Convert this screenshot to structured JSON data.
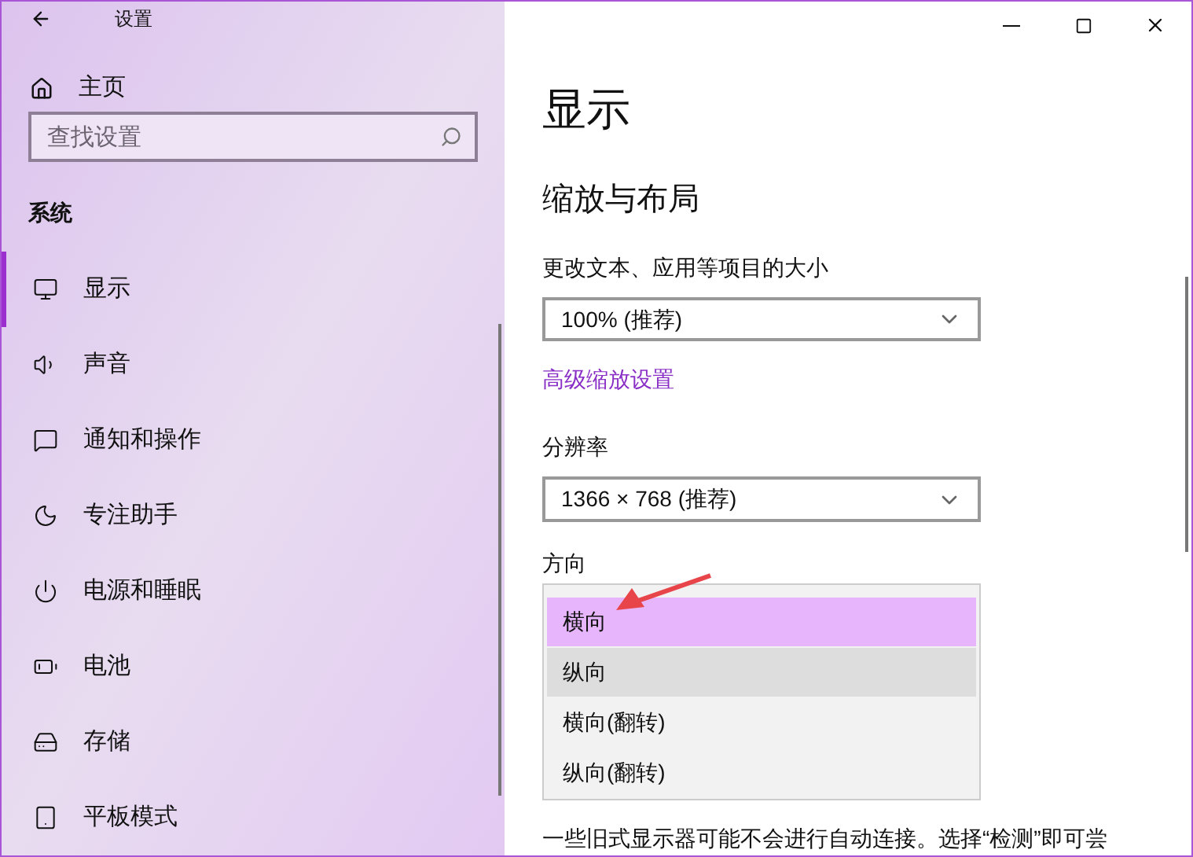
{
  "window": {
    "title": "设置"
  },
  "sidebar": {
    "home": "主页",
    "search": {
      "placeholder": "查找设置"
    },
    "section": "系统",
    "items": [
      {
        "label": "显示",
        "selected": true
      },
      {
        "label": "声音",
        "selected": false
      },
      {
        "label": "通知和操作",
        "selected": false
      },
      {
        "label": "专注助手",
        "selected": false
      },
      {
        "label": "电源和睡眠",
        "selected": false
      },
      {
        "label": "电池",
        "selected": false
      },
      {
        "label": "存储",
        "selected": false
      },
      {
        "label": "平板模式",
        "selected": false
      }
    ]
  },
  "content": {
    "title": "显示",
    "section": "缩放与布局",
    "scale": {
      "label": "更改文本、应用等项目的大小",
      "value": "100% (推荐)"
    },
    "advanced_link": "高级缩放设置",
    "resolution": {
      "label": "分辨率",
      "value": "1366 × 768 (推荐)"
    },
    "orientation": {
      "label": "方向",
      "options": [
        {
          "label": "横向",
          "selected": true,
          "hovered": false
        },
        {
          "label": "纵向",
          "selected": false,
          "hovered": true
        },
        {
          "label": "横向(翻转)",
          "selected": false,
          "hovered": false
        },
        {
          "label": "纵向(翻转)",
          "selected": false,
          "hovered": false
        }
      ]
    },
    "note": "一些旧式显示器可能不会进行自动连接。选择“检测”即可尝"
  }
}
